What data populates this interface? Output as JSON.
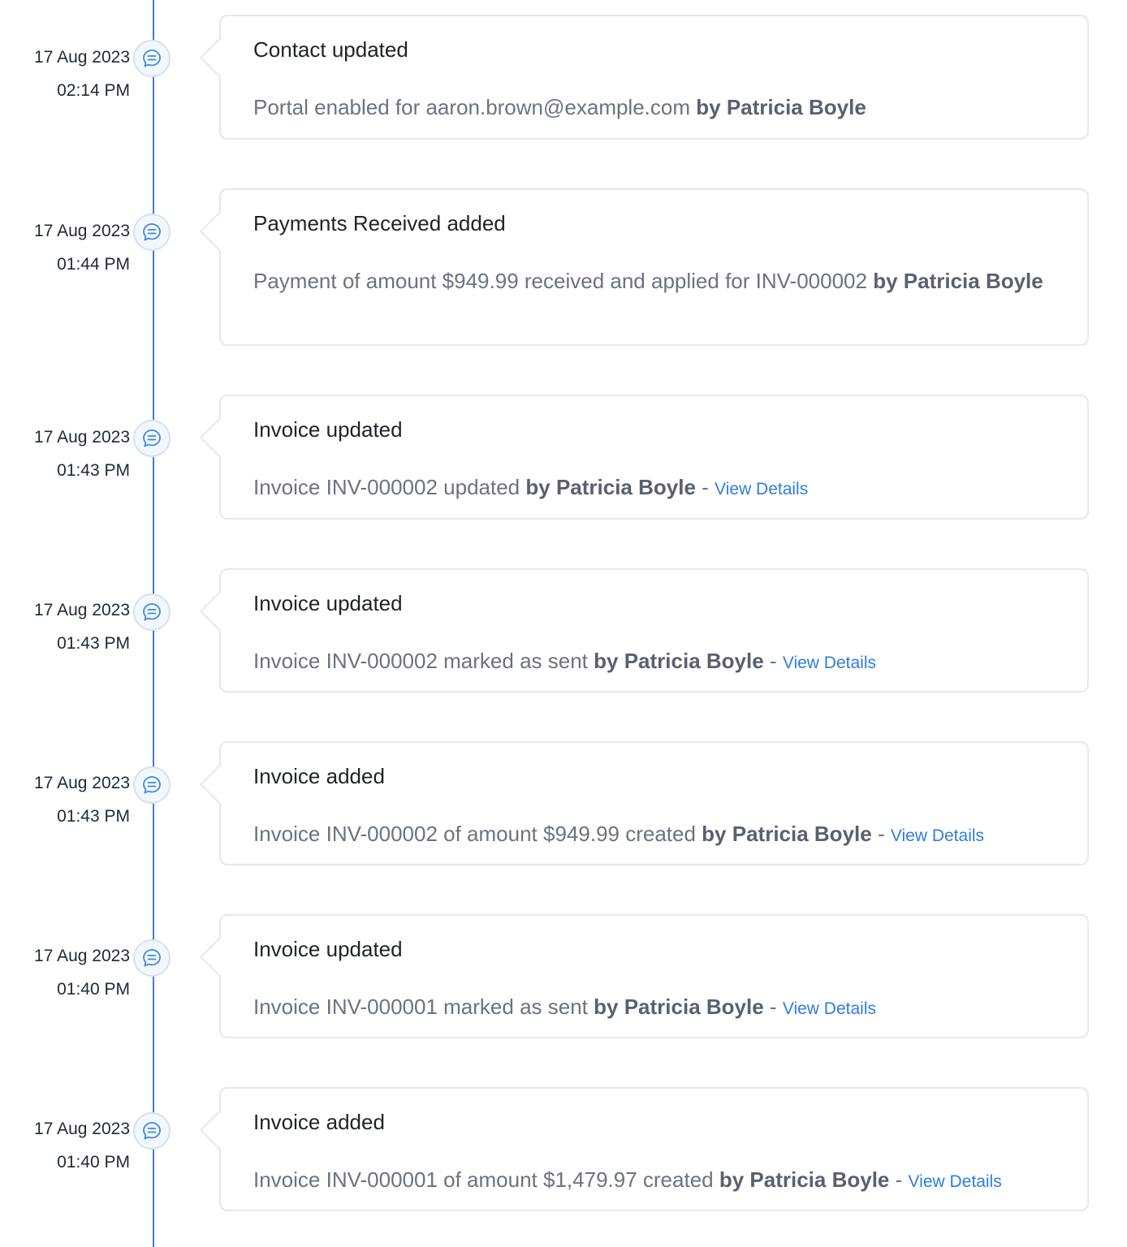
{
  "accent_color": "#3d7ed6",
  "link_color": "#2f7ce0",
  "icon": "chat-bubble-icon",
  "entries": [
    {
      "date": "17 Aug 2023",
      "time": "02:14 PM",
      "title": "Contact updated",
      "text": "Portal enabled for aaron.brown@example.com",
      "by": "by Patricia Boyle",
      "link": ""
    },
    {
      "date": "17 Aug 2023",
      "time": "01:44 PM",
      "title": "Payments Received added",
      "text": "Payment of amount $949.99 received and applied for INV-000002",
      "by": "by Patricia Boyle",
      "link": ""
    },
    {
      "date": "17 Aug 2023",
      "time": "01:43 PM",
      "title": "Invoice updated",
      "text": "Invoice INV-000002 updated",
      "by": "by Patricia Boyle",
      "link": "View Details"
    },
    {
      "date": "17 Aug 2023",
      "time": "01:43 PM",
      "title": "Invoice updated",
      "text": "Invoice INV-000002 marked as sent",
      "by": "by Patricia Boyle",
      "link": "View Details"
    },
    {
      "date": "17 Aug 2023",
      "time": "01:43 PM",
      "title": "Invoice added",
      "text": "Invoice INV-000002 of amount $949.99 created",
      "by": "by Patricia Boyle",
      "link": "View Details"
    },
    {
      "date": "17 Aug 2023",
      "time": "01:40 PM",
      "title": "Invoice updated",
      "text": "Invoice INV-000001 marked as sent",
      "by": "by Patricia Boyle",
      "link": "View Details"
    },
    {
      "date": "17 Aug 2023",
      "time": "01:40 PM",
      "title": "Invoice added",
      "text": "Invoice INV-000001 of amount $1,479.97 created",
      "by": "by Patricia Boyle",
      "link": "View Details"
    }
  ]
}
